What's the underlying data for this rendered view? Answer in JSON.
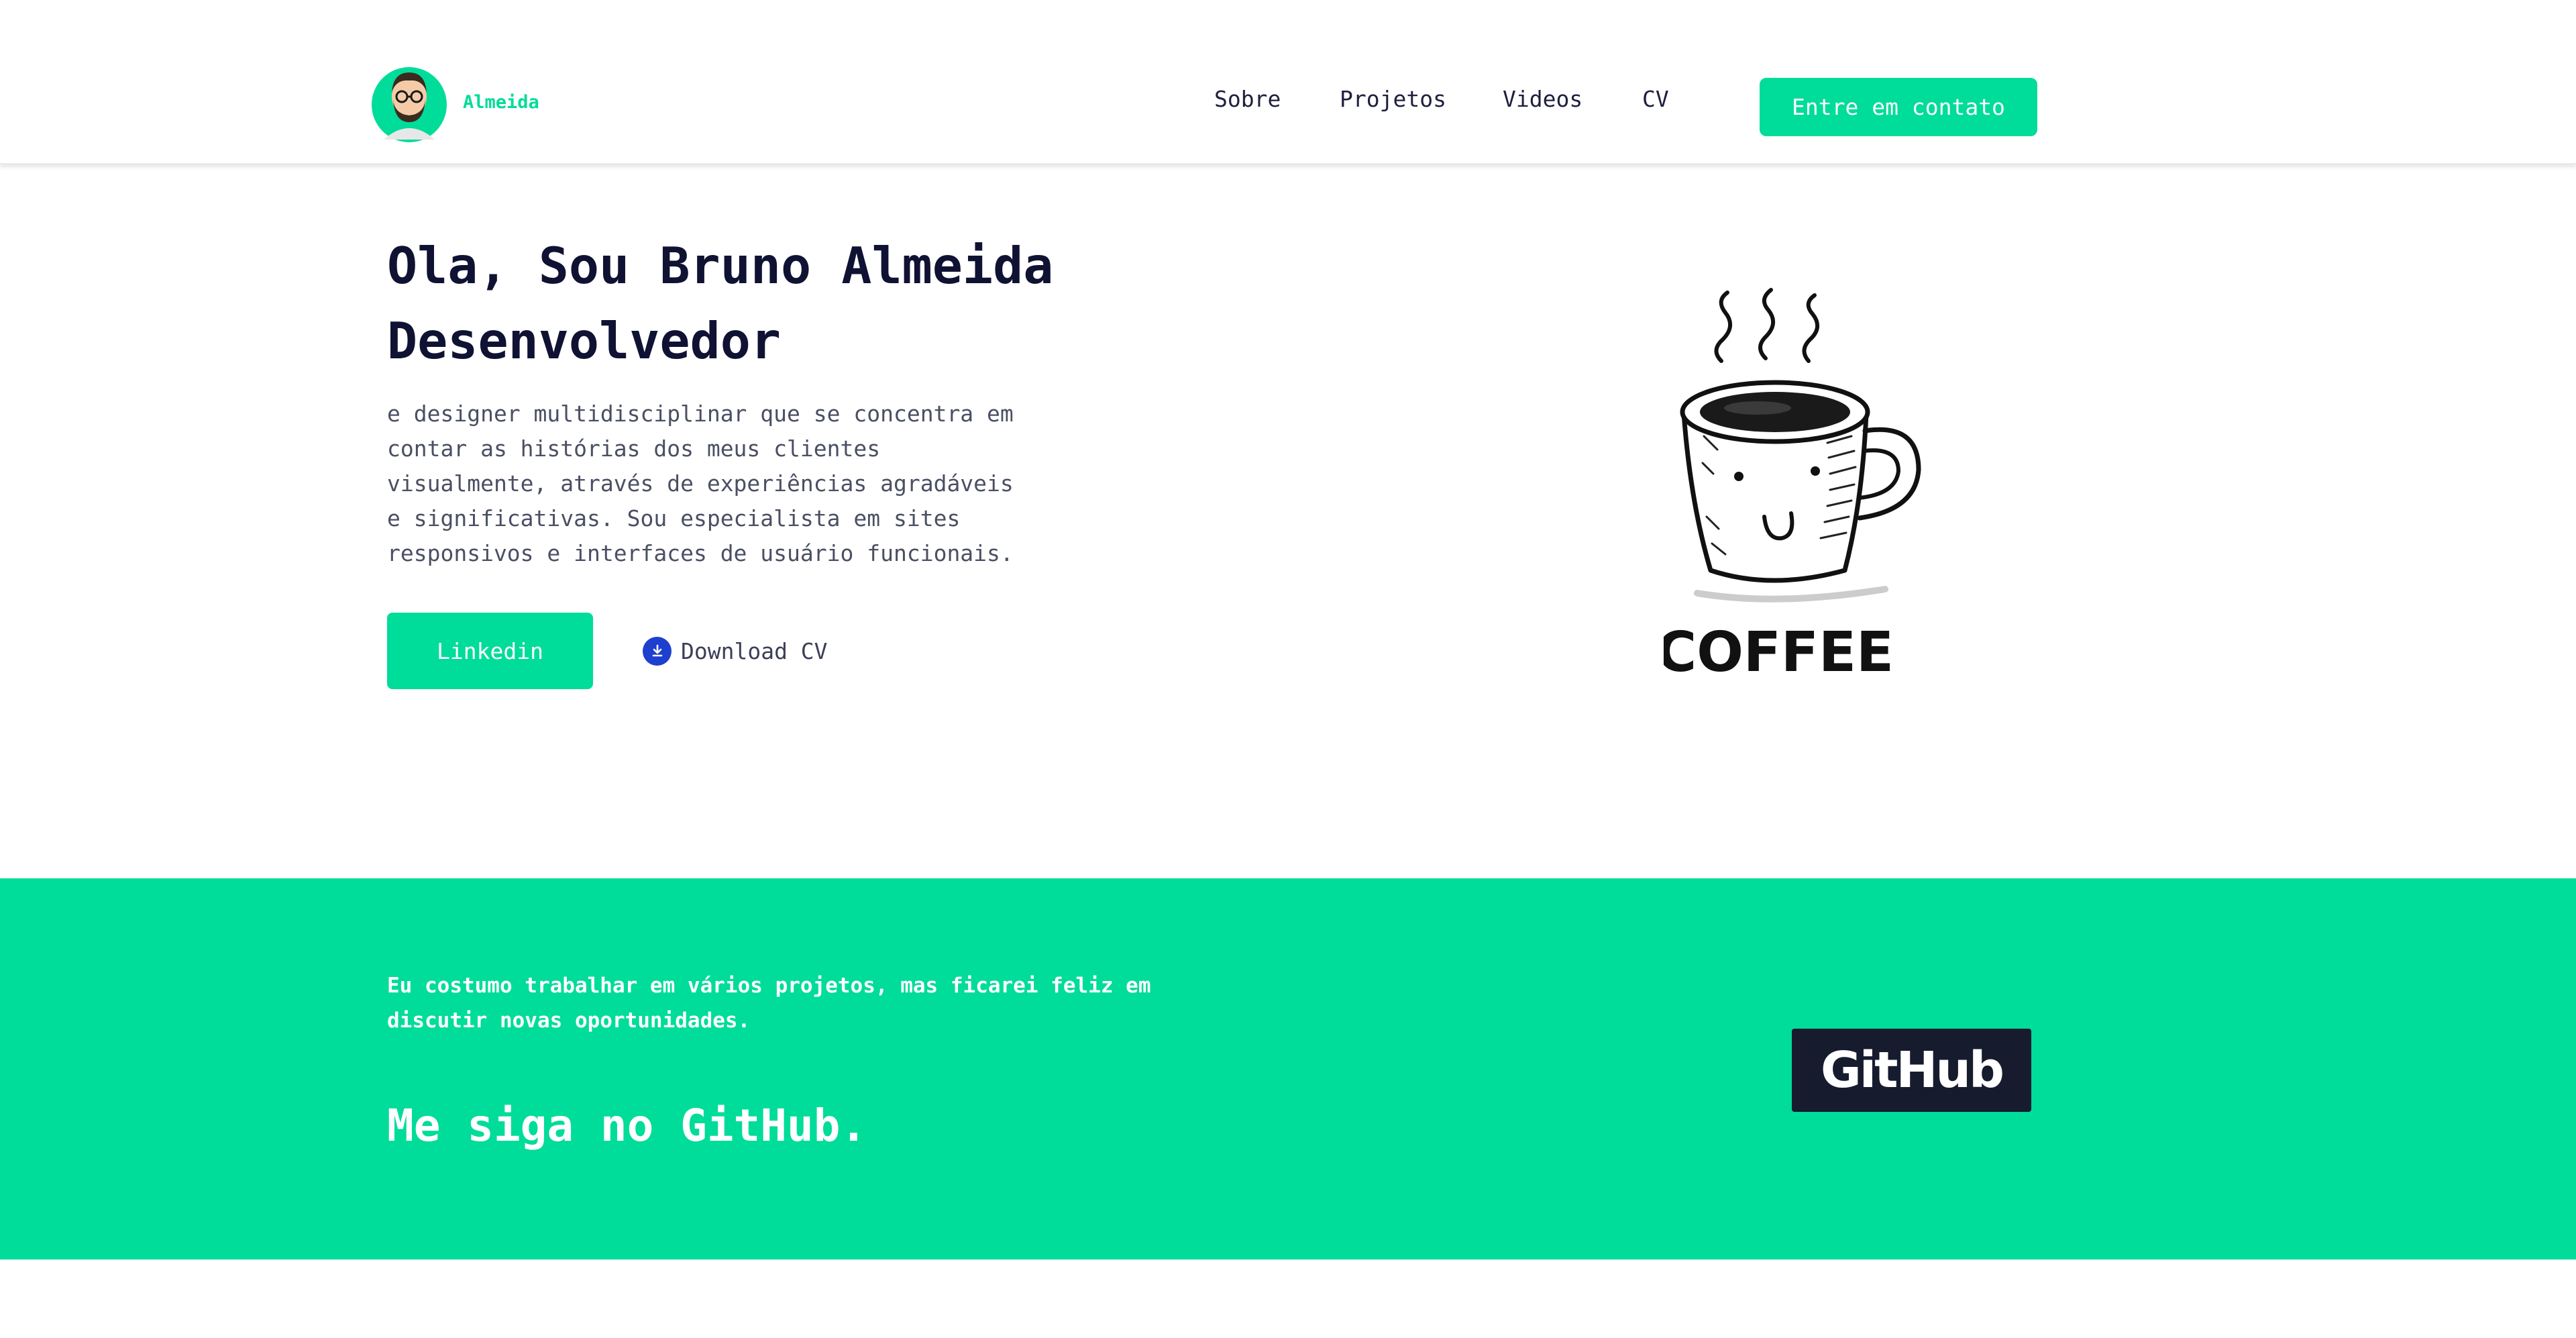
{
  "header": {
    "brand_name": "Almeida",
    "nav": [
      "Sobre",
      "Projetos",
      "Videos",
      "CV"
    ],
    "cta_label": "Entre em contato"
  },
  "hero": {
    "title_lines": [
      "Ola, Sou Bruno Almeida",
      "Desenvolvedor"
    ],
    "description_lines": [
      "e designer multidisciplinar que se concentra em",
      "contar as histórias dos meus clientes",
      "visualmente, através de experiências agradáveis",
      "e significativas. Sou especialista em sites",
      "responsivos e interfaces de usuário funcionais."
    ],
    "linkedin_label": "Linkedin",
    "download_label": "Download CV",
    "coffee_text": "COFFEE"
  },
  "band": {
    "text_lines": [
      "Eu costumo trabalhar em vários projetos, mas ficarei feliz em",
      "discutir novas oportunidades."
    ],
    "title": "Me siga no GitHub.",
    "github_label": "GitHub"
  },
  "colors": {
    "accent": "#00dc99",
    "dark": "#171b2e",
    "download_icon": "#1f3fcf"
  }
}
